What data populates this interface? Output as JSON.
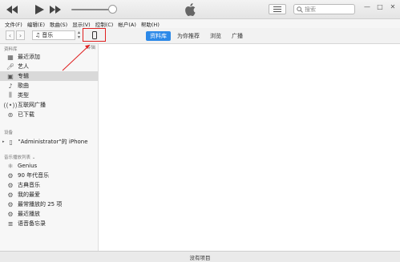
{
  "window": {
    "search_placeholder": "搜索",
    "minimize": "—",
    "maximize": "□",
    "close": "✕"
  },
  "menu": [
    "文件(F)",
    "编辑(E)",
    "歌曲(S)",
    "显示(V)",
    "控制(C)",
    "帐户(A)",
    "帮助(H)"
  ],
  "nav": {
    "media_label": "音乐",
    "tabs": [
      "资料库",
      "为你推荐",
      "浏览",
      "广播"
    ],
    "active_tab": "资料库",
    "album_header": "专辑"
  },
  "sidebar": {
    "library_header": "资料库",
    "library_items": [
      {
        "label": "最近添加",
        "icon": "grid-icon"
      },
      {
        "label": "艺人",
        "icon": "microphone-icon"
      },
      {
        "label": "专辑",
        "icon": "album-icon"
      },
      {
        "label": "歌曲",
        "icon": "music-note-icon"
      },
      {
        "label": "类型",
        "icon": "genre-icon"
      },
      {
        "label": "互联网广播",
        "icon": "radio-icon"
      },
      {
        "label": "已下载",
        "icon": "download-icon"
      }
    ],
    "selected_item": "专辑",
    "devices_header": "设备",
    "device_name": "\"Administrator\"的 iPhone",
    "playlists_header": "音乐播放列表 ⌄",
    "playlists": [
      {
        "label": "Genius",
        "icon": "genius-icon"
      },
      {
        "label": "90 年代音乐",
        "icon": "smart-playlist-icon"
      },
      {
        "label": "古典音乐",
        "icon": "smart-playlist-icon"
      },
      {
        "label": "我的最爱",
        "icon": "smart-playlist-icon"
      },
      {
        "label": "最常播放的 25 项",
        "icon": "smart-playlist-icon"
      },
      {
        "label": "最近播放",
        "icon": "smart-playlist-icon"
      },
      {
        "label": "语音备忘录",
        "icon": "playlist-icon"
      }
    ]
  },
  "status": {
    "text": "没有项目"
  },
  "colors": {
    "accent": "#2c89e8",
    "highlight_box": "#e02020"
  }
}
